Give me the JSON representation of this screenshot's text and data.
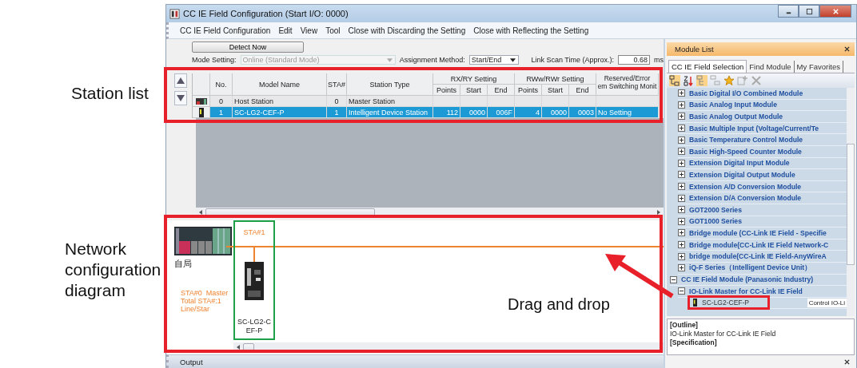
{
  "callouts": [
    {
      "text": "Station list"
    },
    {
      "text": "Network configuration diagram"
    },
    {
      "text": "Drag and drop"
    }
  ],
  "window": {
    "title": "CC IE Field Configuration (Start I/O: 0000)"
  },
  "menu": [
    {
      "label": "CC IE Field Configuration"
    },
    {
      "label": "Edit"
    },
    {
      "label": "View"
    },
    {
      "label": "Tool"
    },
    {
      "label": "Close with Discarding the Setting"
    },
    {
      "label": "Close with Reflecting the Setting"
    }
  ],
  "detect_button": "Detect Now",
  "mode_setting": {
    "label": "Mode Setting:",
    "value": "Online (Standard Mode)",
    "disabled": true
  },
  "assignment_method": {
    "label": "Assignment Method:",
    "value": "Start/End"
  },
  "link_scan_time": {
    "label": "Link Scan Time (Approx.):",
    "value": "0.68",
    "unit": "ms"
  },
  "station_table": {
    "columns": [
      {
        "label": "No."
      },
      {
        "label": "Model Name"
      },
      {
        "label": "STA#"
      },
      {
        "label": "Station Type"
      },
      {
        "label": "RX/RY Setting",
        "sub": [
          "Points",
          "Start",
          "End"
        ]
      },
      {
        "label": "RWw/RWr Setting",
        "sub": [
          "Points",
          "Start",
          "End"
        ]
      },
      {
        "label": "Reserved/Error",
        "label_2": "em Switching Monit"
      }
    ],
    "rows": [
      {
        "kind": "host",
        "no": "0",
        "model": "Host Station",
        "sta": "0",
        "type": "Master Station",
        "selected": false
      },
      {
        "kind": "device",
        "no": "1",
        "model": "SC-LG2-CEF-P",
        "sta": "1",
        "type": "Intelligent Device Station",
        "rx_points": "112",
        "rx_start": "0000",
        "rx_end": "006F",
        "rw_points": "4",
        "rw_start": "0000",
        "rw_end": "0003",
        "reserved": "No Setting",
        "selected": true
      }
    ]
  },
  "diagram": {
    "host": {
      "label": "自局",
      "info": [
        "STA#0  Master",
        "Total STA#:1",
        "Line/Star"
      ]
    },
    "stations": [
      {
        "sta": "STA#1",
        "model": "SC-LG2-CEF-P"
      }
    ]
  },
  "module_list": {
    "title": "Module List",
    "tabs": [
      {
        "label": "CC IE Field Selection",
        "selected": true
      },
      {
        "label": "Find Module",
        "selected": false
      },
      {
        "label": "My Favorites",
        "selected": false
      }
    ],
    "tree": [
      {
        "kind": "category",
        "label": "Basic Digital I/O Combined Module",
        "expanded": false
      },
      {
        "kind": "category",
        "label": "Basic Analog Input Module",
        "expanded": false
      },
      {
        "kind": "category",
        "label": "Basic Analog Output Module",
        "expanded": false
      },
      {
        "kind": "category",
        "label": "Basic Multiple Input (Voltage/Current/Te",
        "expanded": false
      },
      {
        "kind": "category",
        "label": "Basic Temperature Control Module",
        "expanded": false
      },
      {
        "kind": "category",
        "label": "Basic High-Speed Counter Module",
        "expanded": false
      },
      {
        "kind": "category",
        "label": "Extension Digital Input Module",
        "expanded": false
      },
      {
        "kind": "category",
        "label": "Extension Digital Output Module",
        "expanded": false
      },
      {
        "kind": "category",
        "label": "Extension A/D Conversion Module",
        "expanded": false
      },
      {
        "kind": "category",
        "label": "Extension D/A Conversion Module",
        "expanded": false
      },
      {
        "kind": "category",
        "label": "GOT2000 Series",
        "expanded": false
      },
      {
        "kind": "category",
        "label": "GOT1000 Series",
        "expanded": false
      },
      {
        "kind": "category",
        "label": "Bridge module (CC-Link IE Field - Specifie",
        "expanded": false
      },
      {
        "kind": "category",
        "label": "Bridge module(CC-Link IE Field Network-C",
        "expanded": false
      },
      {
        "kind": "category",
        "label": "bridge module(CC-Link IE Field-AnyWireA",
        "expanded": false
      },
      {
        "kind": "category",
        "label": "iQ-F Series（Intelligent Device Unit）",
        "expanded": false
      },
      {
        "kind": "maker",
        "label": "CC IE Field Module (Panasonic Industry)",
        "expanded": true,
        "children": [
          {
            "kind": "category",
            "label": "IO-Link Master for CC-Link IE Field",
            "expanded": true,
            "children": [
              {
                "kind": "module",
                "label": "SC-LG2-CEF-P",
                "note": "Control IO-Li"
              }
            ]
          }
        ]
      }
    ],
    "outline": [
      {
        "kind": "heading",
        "text": "[Outline]"
      },
      {
        "kind": "text",
        "text": "IO-Link Master for CC-Link IE Field"
      },
      {
        "kind": "heading",
        "text": "[Specification]"
      }
    ]
  },
  "output": {
    "label": "Output"
  }
}
